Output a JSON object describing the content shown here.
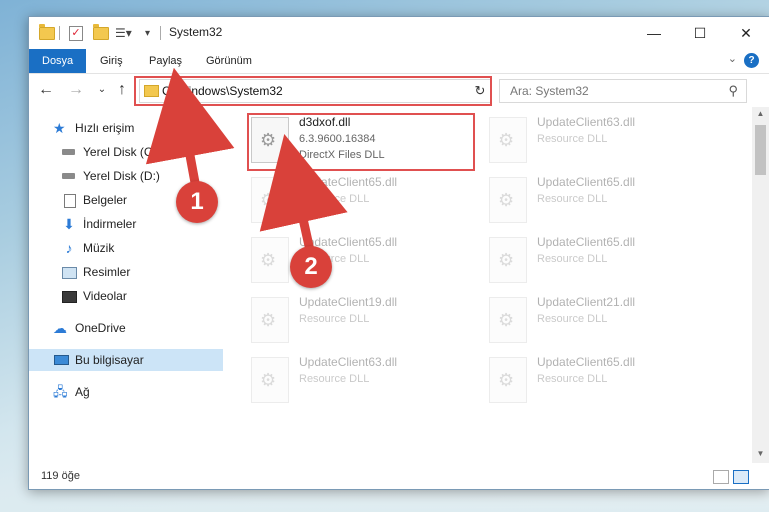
{
  "window": {
    "title": "System32"
  },
  "ribbon": {
    "tabs": [
      {
        "label": "Dosya",
        "active": true
      },
      {
        "label": "Giriş"
      },
      {
        "label": "Paylaş"
      },
      {
        "label": "Görünüm"
      }
    ]
  },
  "address": {
    "path": "C:\\Windows\\System32"
  },
  "search": {
    "placeholder": "Ara: System32"
  },
  "sidebar": {
    "items": [
      {
        "label": "Hızlı erişim",
        "icon": "star-icon"
      },
      {
        "label": "Yerel Disk (C:)",
        "icon": "drive-icon",
        "pinned": true
      },
      {
        "label": "Yerel Disk (D:)",
        "icon": "drive-icon",
        "pinned": true
      },
      {
        "label": "Belgeler",
        "icon": "documents-icon",
        "pinned": true
      },
      {
        "label": "İndirmeler",
        "icon": "download-icon",
        "pinned": true
      },
      {
        "label": "Müzik",
        "icon": "music-icon",
        "pinned": true
      },
      {
        "label": "Resimler",
        "icon": "pictures-icon",
        "pinned": true
      },
      {
        "label": "Videolar",
        "icon": "videos-icon",
        "pinned": true
      },
      {
        "label": "OneDrive",
        "icon": "cloud-icon"
      },
      {
        "label": "Bu bilgisayar",
        "icon": "computer-icon",
        "selected": true
      },
      {
        "label": "Ağ",
        "icon": "network-icon"
      }
    ]
  },
  "files": [
    {
      "name": "d3dxof.dll",
      "version": "6.3.9600.16384",
      "desc": "DirectX Files DLL",
      "highlighted": true
    },
    {
      "name": "UpdateClient63.dll",
      "desc": "Resource DLL"
    },
    {
      "name": "UpdateClient65.dll",
      "desc": "Resource DLL"
    },
    {
      "name": "UpdateClient65.dll",
      "desc": "Resource DLL"
    },
    {
      "name": "UpdateClient65.dll",
      "desc": "Resource DLL"
    },
    {
      "name": "UpdateClient65.dll",
      "desc": "Resource DLL"
    },
    {
      "name": "UpdateClient19.dll",
      "desc": "Resource DLL"
    },
    {
      "name": "UpdateClient21.dll",
      "desc": "Resource DLL"
    },
    {
      "name": "UpdateClient63.dll",
      "desc": "Resource DLL"
    },
    {
      "name": "UpdateClient65.dll",
      "desc": "Resource DLL"
    }
  ],
  "status": {
    "count": "119 öğe"
  },
  "annotations": {
    "step1": "1",
    "step2": "2",
    "color": "#d9413a"
  }
}
